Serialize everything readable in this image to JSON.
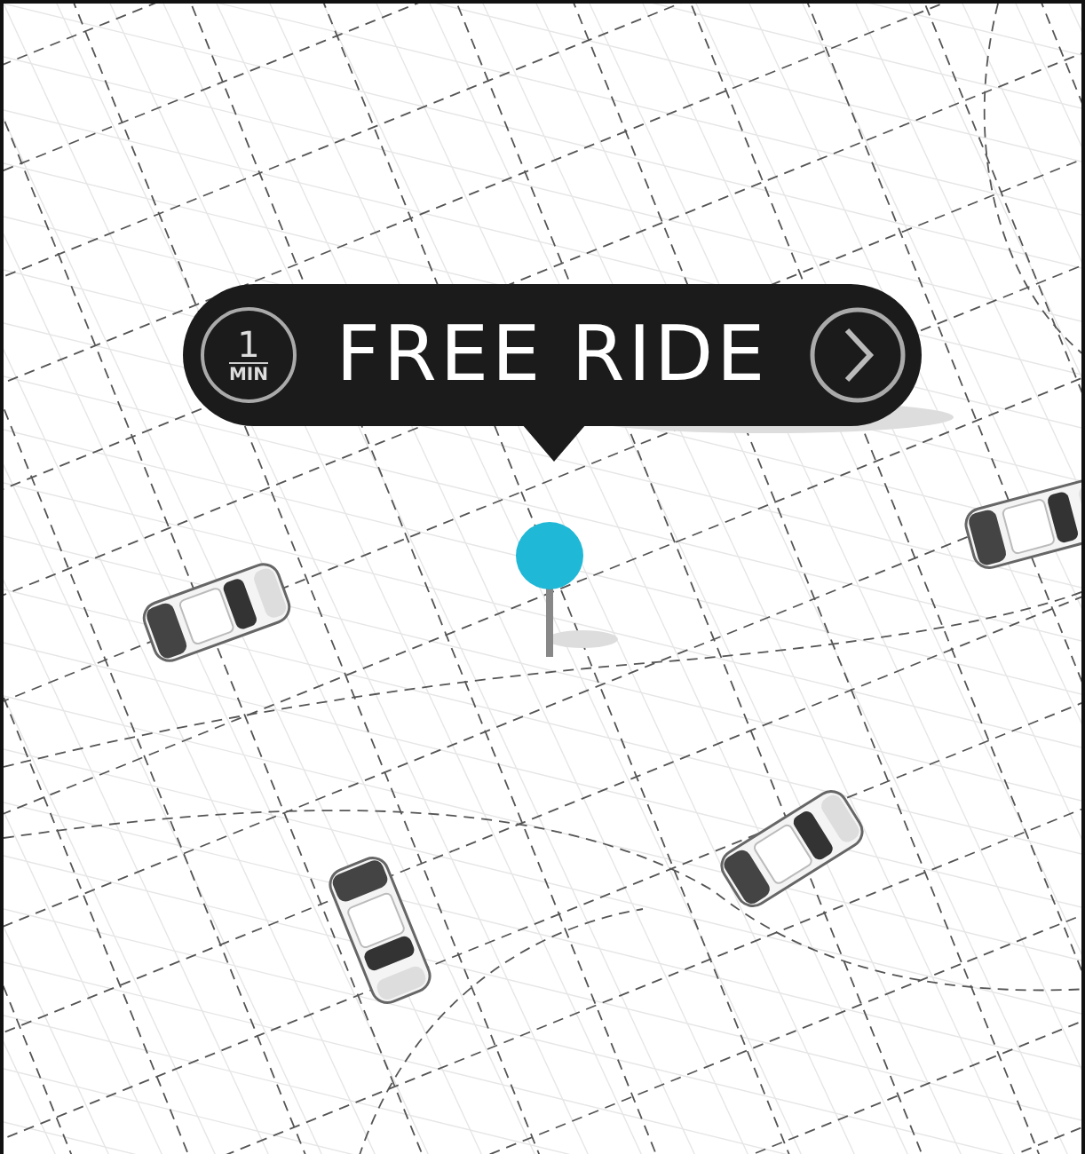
{
  "callout": {
    "eta_value": "1",
    "eta_unit": "MIN",
    "label": "FREE RIDE"
  }
}
